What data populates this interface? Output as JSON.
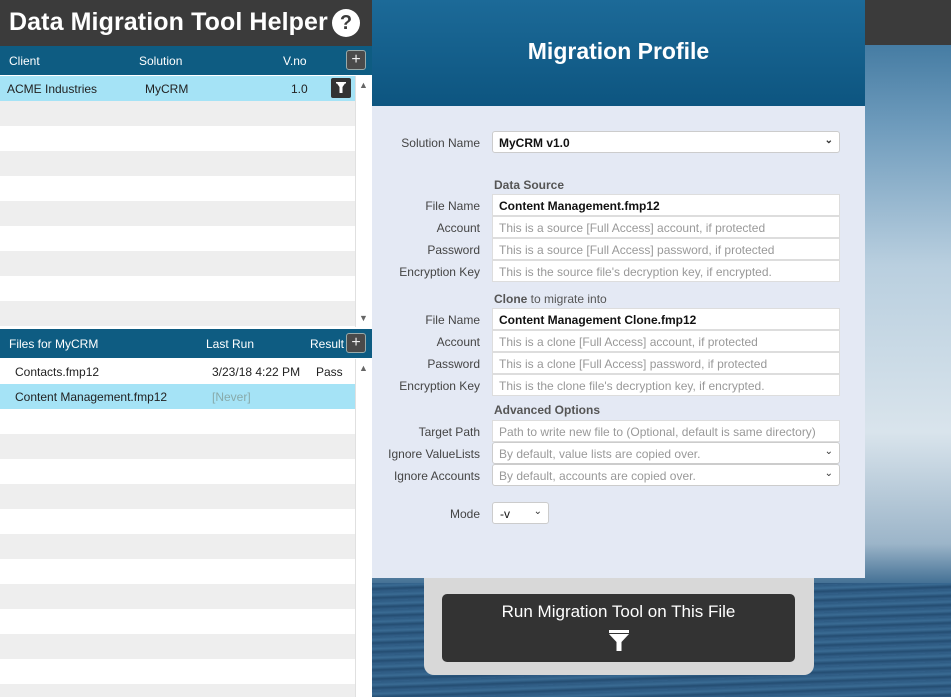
{
  "app": {
    "title": "Data Migration Tool Helper",
    "help": "?"
  },
  "clients": {
    "headers": {
      "client": "Client",
      "solution": "Solution",
      "vno": "V.no"
    },
    "add": "+",
    "rows": [
      {
        "client": "ACME Industries",
        "solution": "MyCRM",
        "vno": "1.0"
      }
    ]
  },
  "files": {
    "headers": {
      "title": "Files for MyCRM",
      "last_run": "Last Run",
      "result": "Result"
    },
    "add": "+",
    "rows": [
      {
        "name": "Contacts.fmp12",
        "last_run": "3/23/18 4:22 PM",
        "result": "Pass"
      },
      {
        "name": "Content Management.fmp12",
        "last_run": "[Never]",
        "result": ""
      }
    ]
  },
  "profile": {
    "title": "Migration Profile",
    "solution_label": "Solution Name",
    "solution_value": "MyCRM v1.0",
    "data_source": {
      "section": "Data Source",
      "file_label": "File Name",
      "file_value": "Content Management.fmp12",
      "account_label": "Account",
      "account_placeholder": "This is a source [Full Access] account, if protected",
      "password_label": "Password",
      "password_placeholder": "This is a source [Full Access] password, if protected",
      "key_label": "Encryption Key",
      "key_placeholder": "This is the source file's decryption key, if encrypted."
    },
    "clone": {
      "section_bold": "Clone",
      "section_rest": " to migrate into",
      "file_label": "File Name",
      "file_value": "Content Management Clone.fmp12",
      "account_label": "Account",
      "account_placeholder": "This is a clone [Full Access] account, if protected",
      "password_label": "Password",
      "password_placeholder": "This is a clone [Full Access] password, if protected",
      "key_label": "Encryption Key",
      "key_placeholder": "This is the clone file's decryption key, if encrypted."
    },
    "advanced": {
      "section": "Advanced Options",
      "target_label": "Target Path",
      "target_placeholder": "Path to write new file to (Optional, default is same directory)",
      "valuelists_label": "Ignore ValueLists",
      "valuelists_value": "By default, value lists are copied over.",
      "accounts_label": "Ignore Accounts",
      "accounts_value": "By default, accounts are copied over."
    },
    "mode_label": "Mode",
    "mode_value": "-v"
  },
  "run": {
    "label": "Run Migration Tool on This File"
  },
  "icons": {
    "help": "help-icon",
    "funnel": "funnel-icon",
    "add": "plus-icon",
    "chevron": "chevron-down-icon"
  }
}
